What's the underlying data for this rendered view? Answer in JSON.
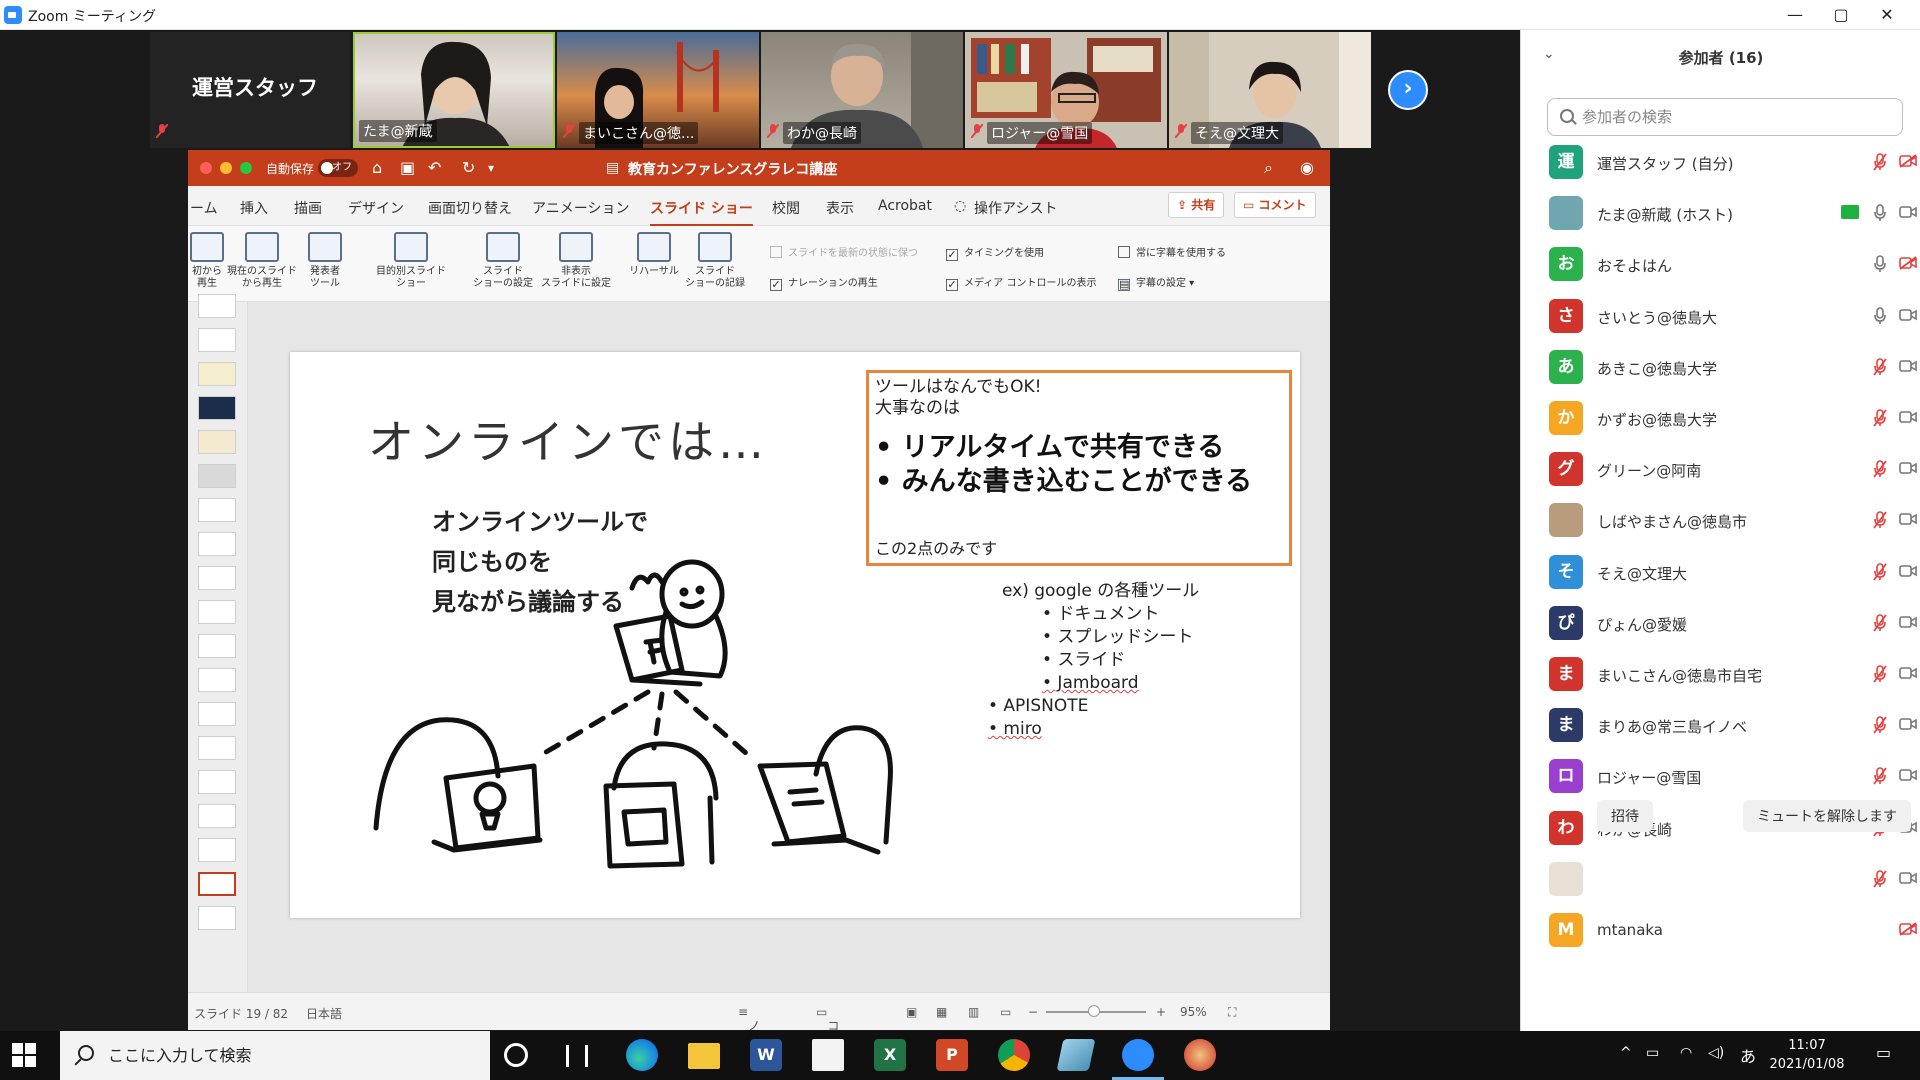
{
  "window": {
    "title": "Zoom ミーティング",
    "minimize": "—",
    "maximize": "▢",
    "close": "✕"
  },
  "gallery": {
    "staff_label": "運営スタッフ",
    "tiles": [
      {
        "name": "たま@新蔵"
      },
      {
        "name": "まいこさん@徳..."
      },
      {
        "name": "わか@長崎"
      },
      {
        "name": "ロジャー@雪国"
      },
      {
        "name": "そえ@文理大"
      }
    ],
    "next_arrow": "›"
  },
  "ppt": {
    "autosave_label": "自動保存",
    "autosave_state": "オフ",
    "document_title": "教育カンファレンスグラレコ講座",
    "tabs": [
      "ーム",
      "挿入",
      "描画",
      "デザイン",
      "画面切り替え",
      "アニメーション",
      "スライド ショー",
      "校閲",
      "表示",
      "Acrobat",
      "操作アシスト"
    ],
    "active_tab": "スライド ショー",
    "share_label": "共有",
    "comment_label": "コメント",
    "ribbon": {
      "buttons": [
        {
          "line1": "初から",
          "line2": "再生"
        },
        {
          "line1": "現在のスライド",
          "line2": "から再生"
        },
        {
          "line1": "発表者",
          "line2": "ツール"
        },
        {
          "line1": "目的別スライド",
          "line2": "ショー"
        },
        {
          "line1": "スライド",
          "line2": "ショーの設定"
        },
        {
          "line1": "非表示",
          "line2": "スライドに設定"
        },
        {
          "line1": "リハーサル",
          "line2": ""
        },
        {
          "line1": "スライド",
          "line2": "ショーの記録"
        }
      ],
      "checks": [
        {
          "label": "スライドを最新の状態に保つ",
          "checked": false,
          "disabled": true
        },
        {
          "label": "タイミングを使用",
          "checked": true,
          "disabled": false
        },
        {
          "label": "ナレーションの再生",
          "checked": true,
          "disabled": false
        },
        {
          "label": "メディア コントロールの表示",
          "checked": true,
          "disabled": false
        },
        {
          "label": "常に字幕を使用する",
          "checked": false,
          "disabled": false
        },
        {
          "label": "字幕の設定",
          "checked": false,
          "disabled": false
        }
      ]
    },
    "slide": {
      "heading": "オンラインでは…",
      "lead": [
        "オンラインツールで",
        "同じものを",
        "見ながら議論する"
      ],
      "callout_intro": [
        "ツールはなんでもOK!",
        "大事なのは"
      ],
      "callout_points": [
        "• リアルタイムで共有できる",
        "• みんな書き込むことができる"
      ],
      "callout_footer": "この2点のみです",
      "ex_title": "ex) google の各種ツール",
      "ex_items": [
        "•   ドキュメント",
        "•   スプレッドシート",
        "•   スライド",
        "•   Jamboard"
      ],
      "other_items": [
        "•   APISNOTE",
        "•   miro"
      ]
    },
    "status": {
      "slide_counter": "スライド 19 / 82",
      "language": "日本語",
      "notes": "ノート",
      "comments": "コメント",
      "zoom": "95%"
    }
  },
  "participants": {
    "title": "参加者 (16)",
    "search_placeholder": "参加者の検索",
    "list": [
      {
        "initial": "運",
        "color": "#1fa37c",
        "name": "運営スタッフ (自分)",
        "mic": "off",
        "cam": "off"
      },
      {
        "initial": "",
        "color": "#6fa6b0",
        "name": "たま@新蔵 (ホスト)",
        "mic": "on",
        "cam": "on",
        "sharing": true
      },
      {
        "initial": "お",
        "color": "#2bb24c",
        "name": "おそよはん",
        "mic": "on",
        "cam": "off"
      },
      {
        "initial": "さ",
        "color": "#d0342c",
        "name": "さいとう@徳島大",
        "mic": "on",
        "cam": "on"
      },
      {
        "initial": "あ",
        "color": "#2bb24c",
        "name": "あきこ@徳島大学",
        "mic": "off",
        "cam": "on"
      },
      {
        "initial": "か",
        "color": "#f5a623",
        "name": "かずお@徳島大学",
        "mic": "off",
        "cam": "on"
      },
      {
        "initial": "グ",
        "color": "#d0342c",
        "name": "グリーン@阿南",
        "mic": "off",
        "cam": "on"
      },
      {
        "initial": "",
        "color": "#b89c7d",
        "name": "しばやまさん@徳島市",
        "mic": "off",
        "cam": "on"
      },
      {
        "initial": "そ",
        "color": "#2f8fd8",
        "name": "そえ@文理大",
        "mic": "off",
        "cam": "on"
      },
      {
        "initial": "ぴ",
        "color": "#2b3a67",
        "name": "ぴょん@愛媛",
        "mic": "off",
        "cam": "on"
      },
      {
        "initial": "ま",
        "color": "#d0342c",
        "name": "まいこさん@徳島市自宅",
        "mic": "off",
        "cam": "on"
      },
      {
        "initial": "ま",
        "color": "#2b3a67",
        "name": "まりあ@常三島イノベ",
        "mic": "off",
        "cam": "on"
      },
      {
        "initial": "ロ",
        "color": "#9b3fcf",
        "name": "ロジャー@雪国",
        "mic": "off",
        "cam": "on"
      },
      {
        "initial": "わ",
        "color": "#d0342c",
        "name": "わか@長崎",
        "mic": "off",
        "cam": "on"
      },
      {
        "initial": "",
        "color": "#e9e0d5",
        "name": "",
        "mic": "off",
        "cam": "on"
      },
      {
        "initial": "M",
        "color": "#f5a623",
        "name": "mtanaka",
        "mic": "none",
        "cam": "off"
      }
    ],
    "invite_label": "招待",
    "unmute_label": "ミュートを解除します"
  },
  "taskbar": {
    "search_placeholder": "ここに入力して検索",
    "time": "11:07",
    "date": "2021/01/08",
    "ime": "あ"
  }
}
